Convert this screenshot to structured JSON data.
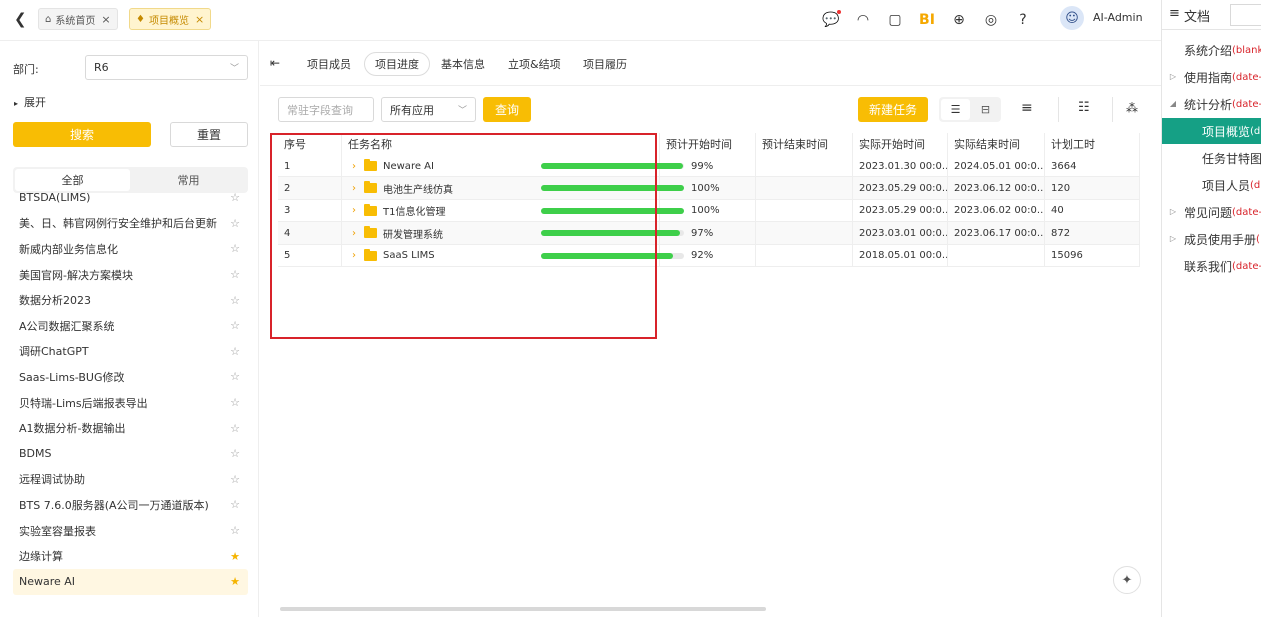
{
  "topbar": {
    "tabs": [
      {
        "label": "系统首页",
        "close": "×"
      },
      {
        "label": "项目概览",
        "close": "×"
      }
    ],
    "brand_label": "BI",
    "user_name": "AI-Admin"
  },
  "left": {
    "dept_label": "部门:",
    "dept_value": "R6",
    "expand_label": "展开",
    "search_button": "搜索",
    "reset_button": "重置",
    "segments": [
      "全部",
      "常用"
    ],
    "projects": [
      {
        "name": "BTSDA(LIMS)",
        "fav": false
      },
      {
        "name": "美、日、韩官网例行安全维护和后台更新",
        "fav": false
      },
      {
        "name": "新威内部业务信息化",
        "fav": false
      },
      {
        "name": "美国官网-解决方案模块",
        "fav": false
      },
      {
        "name": "数据分析2023",
        "fav": false
      },
      {
        "name": "A公司数据汇聚系统",
        "fav": false
      },
      {
        "name": "调研ChatGPT",
        "fav": false
      },
      {
        "name": "Saas-Lims-BUG修改",
        "fav": false
      },
      {
        "name": "贝特瑞-Lims后端报表导出",
        "fav": false
      },
      {
        "name": "A1数据分析-数据输出",
        "fav": false
      },
      {
        "name": "BDMS",
        "fav": false
      },
      {
        "name": "远程调试协助",
        "fav": false
      },
      {
        "name": "BTS 7.6.0服务器(A公司一万通道版本)",
        "fav": false
      },
      {
        "name": "实验室容量报表",
        "fav": false
      },
      {
        "name": "边缘计算",
        "fav": true
      },
      {
        "name": "Neware AI",
        "fav": true
      }
    ]
  },
  "main": {
    "tabs": [
      "项目成员",
      "项目进度",
      "基本信息",
      "立项&结项",
      "项目履历"
    ],
    "active_tab": 1,
    "filter_placeholder": "常驻字段查询",
    "app_select": "所有应用",
    "query_button": "查询",
    "new_task_button": "新建任务",
    "columns": [
      "序号",
      "任务名称",
      "预计开始时间",
      "预计结束时间",
      "实际开始时间",
      "实际结束时间",
      "计划工时"
    ],
    "rows": [
      {
        "no": "1",
        "name": "Neware AI",
        "progress": 99,
        "pct": "99%",
        "pstart": "",
        "pend": "",
        "astart": "2023.01.30 00:0...",
        "aend": "2024.05.01 00:0...",
        "hours": "3664"
      },
      {
        "no": "2",
        "name": "电池生产线仿真",
        "progress": 100,
        "pct": "100%",
        "pstart": "",
        "pend": "",
        "astart": "2023.05.29 00:0...",
        "aend": "2023.06.12 00:0...",
        "hours": "120"
      },
      {
        "no": "3",
        "name": "T1信息化管理",
        "progress": 100,
        "pct": "100%",
        "pstart": "",
        "pend": "",
        "astart": "2023.05.29 00:0...",
        "aend": "2023.06.02 00:0...",
        "hours": "40"
      },
      {
        "no": "4",
        "name": "研发管理系统",
        "progress": 97,
        "pct": "97%",
        "pstart": "",
        "pend": "",
        "astart": "2023.03.01 00:0...",
        "aend": "2023.06.17 00:0...",
        "hours": "872"
      },
      {
        "no": "5",
        "name": "SaaS LIMS",
        "progress": 92,
        "pct": "92%",
        "pstart": "",
        "pend": "",
        "astart": "2018.05.01 00:0...",
        "aend": "",
        "hours": "15096"
      }
    ]
  },
  "docs": {
    "header": "文档",
    "items": [
      {
        "label": "系统介绍",
        "sub": "(blank",
        "tri": ""
      },
      {
        "label": "使用指南",
        "sub": "(date-",
        "tri": "▷"
      },
      {
        "label": "统计分析",
        "sub": "(date-",
        "tri": "◢"
      },
      {
        "label": "项目概览",
        "sub": "(d",
        "tri": "",
        "selected": true
      },
      {
        "label": "任务甘特图",
        "sub": "",
        "tri": ""
      },
      {
        "label": "项目人员",
        "sub": "(d",
        "tri": ""
      },
      {
        "label": "常见问题",
        "sub": "(date-",
        "tri": "▷"
      },
      {
        "label": "成员使用手册",
        "sub": "(",
        "tri": "▷"
      },
      {
        "label": "联系我们",
        "sub": "(date-",
        "tri": ""
      }
    ]
  },
  "colors": {
    "accent": "#f8bd04",
    "progress": "#3ecf4a",
    "highlight": "#d8232a",
    "doc_selected": "#15a085"
  }
}
